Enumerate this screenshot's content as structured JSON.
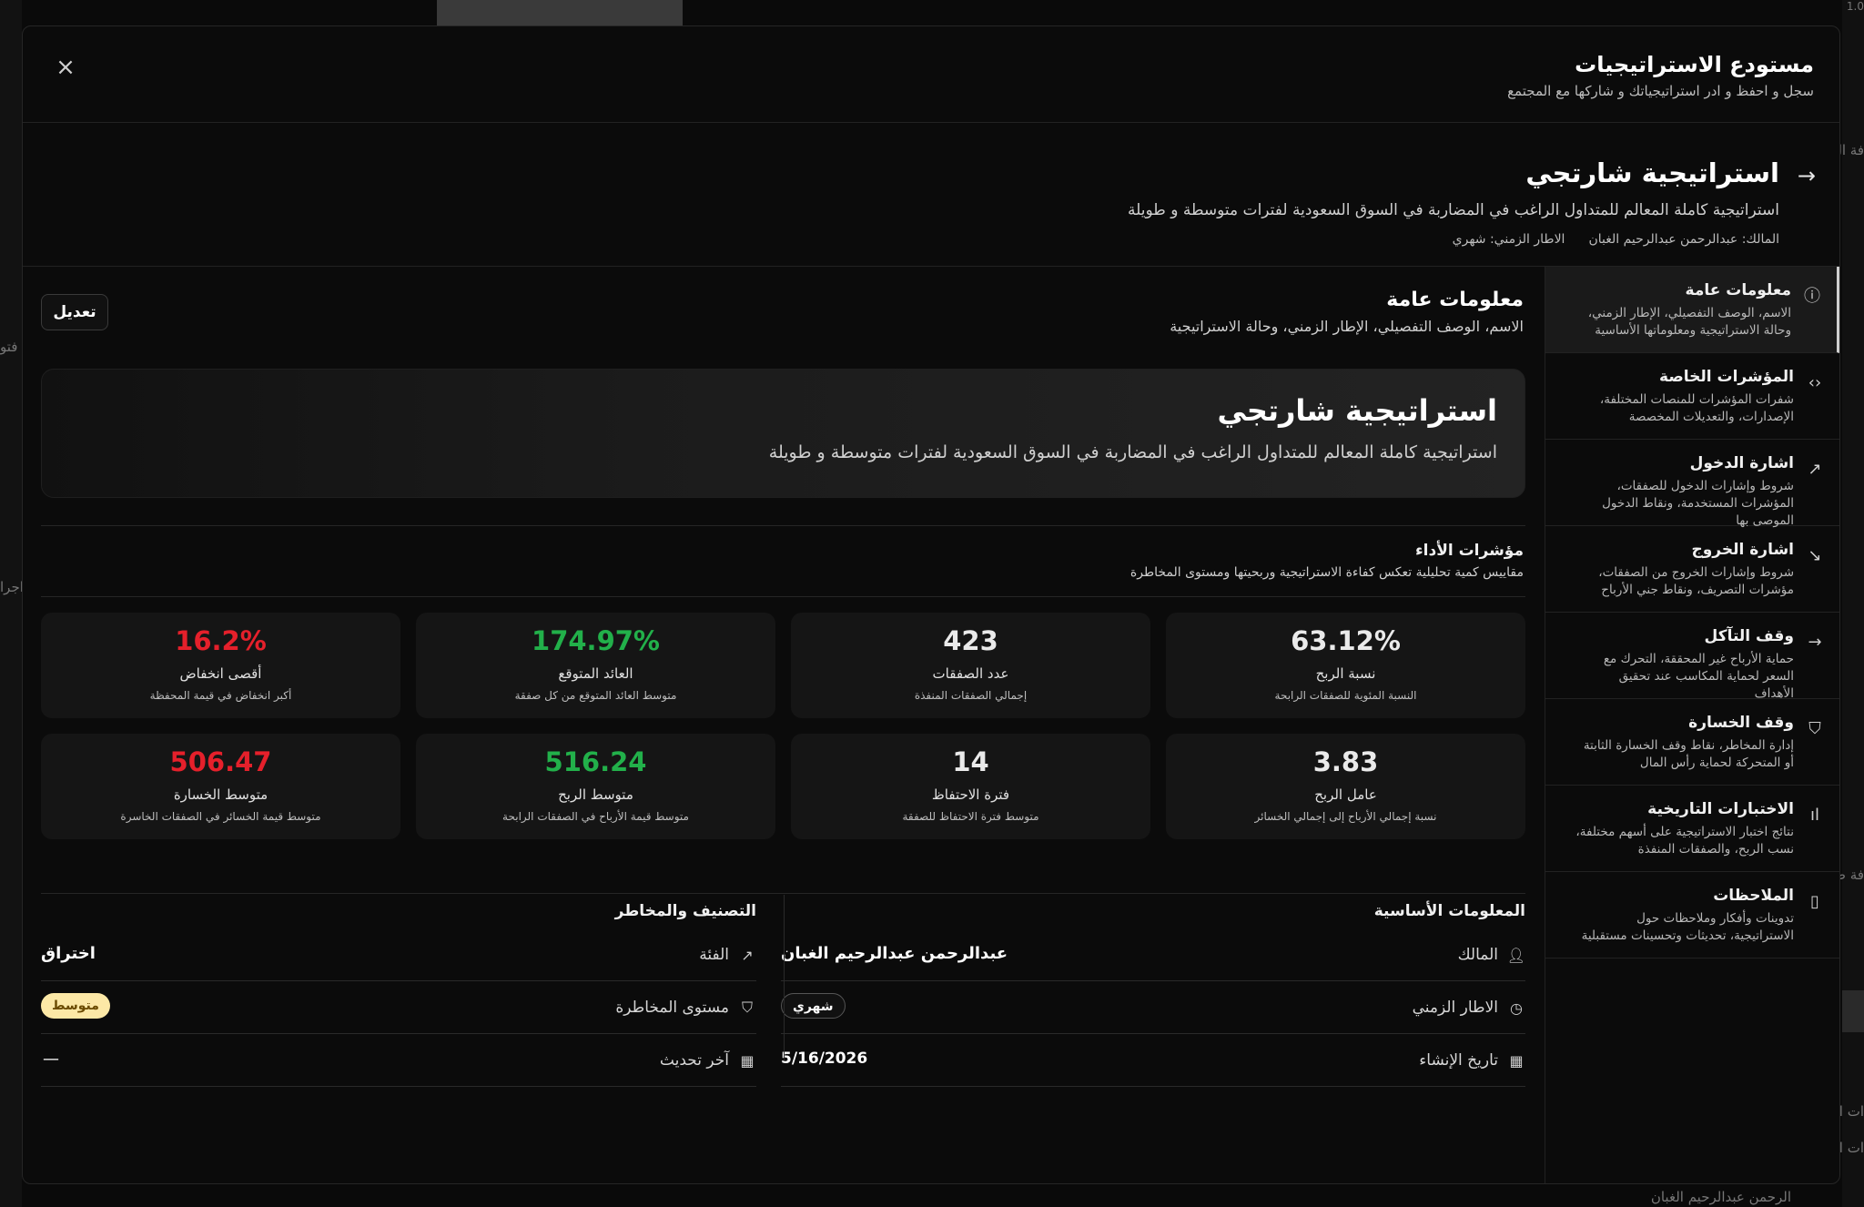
{
  "background": {
    "left_labels": [
      "فتو",
      "اجرا"
    ],
    "right_labels": [
      "فة ال",
      "فة ص",
      "ات ا",
      "ات ا"
    ],
    "bottom_text": "الرحمن عبدالرحيم الغبان",
    "top_right_number": "1.0"
  },
  "modal": {
    "title": "مستودع الاستراتيجيات",
    "subtitle": "سجل و احفظ و ادر استراتيجياتك و شاركها مع المجتمع",
    "close_symbol": "×"
  },
  "strategy": {
    "arrow": "→",
    "name": "استراتيجية شارتجي",
    "description": "استراتيجية كاملة المعالم للمتداول الراغب في المضاربة في السوق السعودية لفترات متوسطة و طويلة",
    "owner_meta": "المالك: عبدالرحمن عبدالرحيم الغبان",
    "timeframe_meta": "الاطار الزمني: شهري"
  },
  "sidebar": {
    "items": [
      {
        "title": "معلومات عامة",
        "desc": "الاسم، الوصف التفصيلي، الإطار الزمني، وحالة الاستراتيجية ومعلوماتها الأساسية",
        "icon": "info-icon",
        "glyph": "ⓘ"
      },
      {
        "title": "المؤشرات الخاصة",
        "desc": "شفرات المؤشرات للمنصات المختلفة، الإصدارات، والتعديلات المخصصة",
        "icon": "code-icon",
        "glyph": "‹›"
      },
      {
        "title": "اشارة الدخول",
        "desc": "شروط وإشارات الدخول للصفقات، المؤشرات المستخدمة، ونقاط الدخول الموصى بها",
        "icon": "trending-up-icon",
        "glyph": "↗"
      },
      {
        "title": "اشارة الخروج",
        "desc": "شروط وإشارات الخروج من الصفقات، مؤشرات التصريف، ونقاط جني الأرباح",
        "icon": "trending-down-icon",
        "glyph": "↘"
      },
      {
        "title": "وقف التآكل",
        "desc": "حماية الأرباح غير المحققة، التحرك مع السعر لحماية المكاسب عند تحقيق الأهداف",
        "icon": "arrow-right-icon",
        "glyph": "→"
      },
      {
        "title": "وقف الخسارة",
        "desc": "إدارة المخاطر، نقاط وقف الخسارة الثابتة أو المتحركة لحماية رأس المال",
        "icon": "shield-icon",
        "glyph": "⛉"
      },
      {
        "title": "الاختبارات التاريخية",
        "desc": "نتائج اختبار الاستراتيجية على أسهم مختلفة، نسب الربح، والصفقات المنفذة",
        "icon": "bar-chart-icon",
        "glyph": "ıl"
      },
      {
        "title": "الملاحظات",
        "desc": "تدوينات وأفكار وملاحظات حول الاستراتيجية، تحديثات وتحسينات مستقبلية",
        "icon": "file-icon",
        "glyph": "▯"
      }
    ]
  },
  "general": {
    "title": "معلومات عامة",
    "subtitle": "الاسم، الوصف التفصيلي، الإطار الزمني، وحالة الاستراتيجية",
    "edit_label": "تعديل",
    "card_title": "استراتيجية شارتجي",
    "card_desc": "استراتيجية كاملة المعالم للمتداول الراغب في المضاربة في السوق السعودية لفترات متوسطة و طويلة"
  },
  "performance": {
    "title": "مؤشرات الأداء",
    "subtitle": "مقاييس كمية تحليلية تعكس كفاءة الاستراتيجية وربحيتها ومستوى المخاطرة",
    "stats": [
      {
        "value": "63.12%",
        "label": "نسبة الربح",
        "note": "النسبة المئوية للصفقات الرابحة",
        "tone": "neutral"
      },
      {
        "value": "423",
        "label": "عدد الصفقات",
        "note": "إجمالي الصفقات المنفذة",
        "tone": "neutral"
      },
      {
        "value": "174.97%",
        "label": "العائد المتوقع",
        "note": "متوسط العائد المتوقع من كل صفقة",
        "tone": "green"
      },
      {
        "value": "16.2%",
        "label": "أقصى انخفاض",
        "note": "أكبر انخفاض في قيمة المحفظة",
        "tone": "red"
      },
      {
        "value": "3.83",
        "label": "عامل الربح",
        "note": "نسبة إجمالي الأرباح إلى إجمالي الخسائر",
        "tone": "neutral"
      },
      {
        "value": "14",
        "label": "فترة الاحتفاظ",
        "note": "متوسط فترة الاحتفاظ للصفقة",
        "tone": "neutral"
      },
      {
        "value": "516.24",
        "label": "متوسط الربح",
        "note": "متوسط قيمة الأرباح في الصفقات الرابحة",
        "tone": "green"
      },
      {
        "value": "506.47",
        "label": "متوسط الخسارة",
        "note": "متوسط قيمة الخسائر في الصفقات الخاسرة",
        "tone": "red"
      }
    ]
  },
  "basic": {
    "title": "المعلومات الأساسية",
    "owner_label": "المالك",
    "owner_value": "عبدالرحمن عبدالرحيم الغبان",
    "timeframe_label": "الاطار الزمني",
    "timeframe_value": "شهري",
    "created_label": "تاريخ الإنشاء",
    "created_value": "5/16/2026"
  },
  "classification": {
    "title": "التصنيف والمخاطر",
    "category_label": "الفئة",
    "category_value": "اختراق",
    "risk_label": "مستوى المخاطرة",
    "risk_value": "متوسط",
    "updated_label": "آخر تحديث",
    "updated_value": "—"
  },
  "colors": {
    "positive": "#22b04a",
    "negative": "#e5202b",
    "risk_badge": "#fce8a6"
  }
}
